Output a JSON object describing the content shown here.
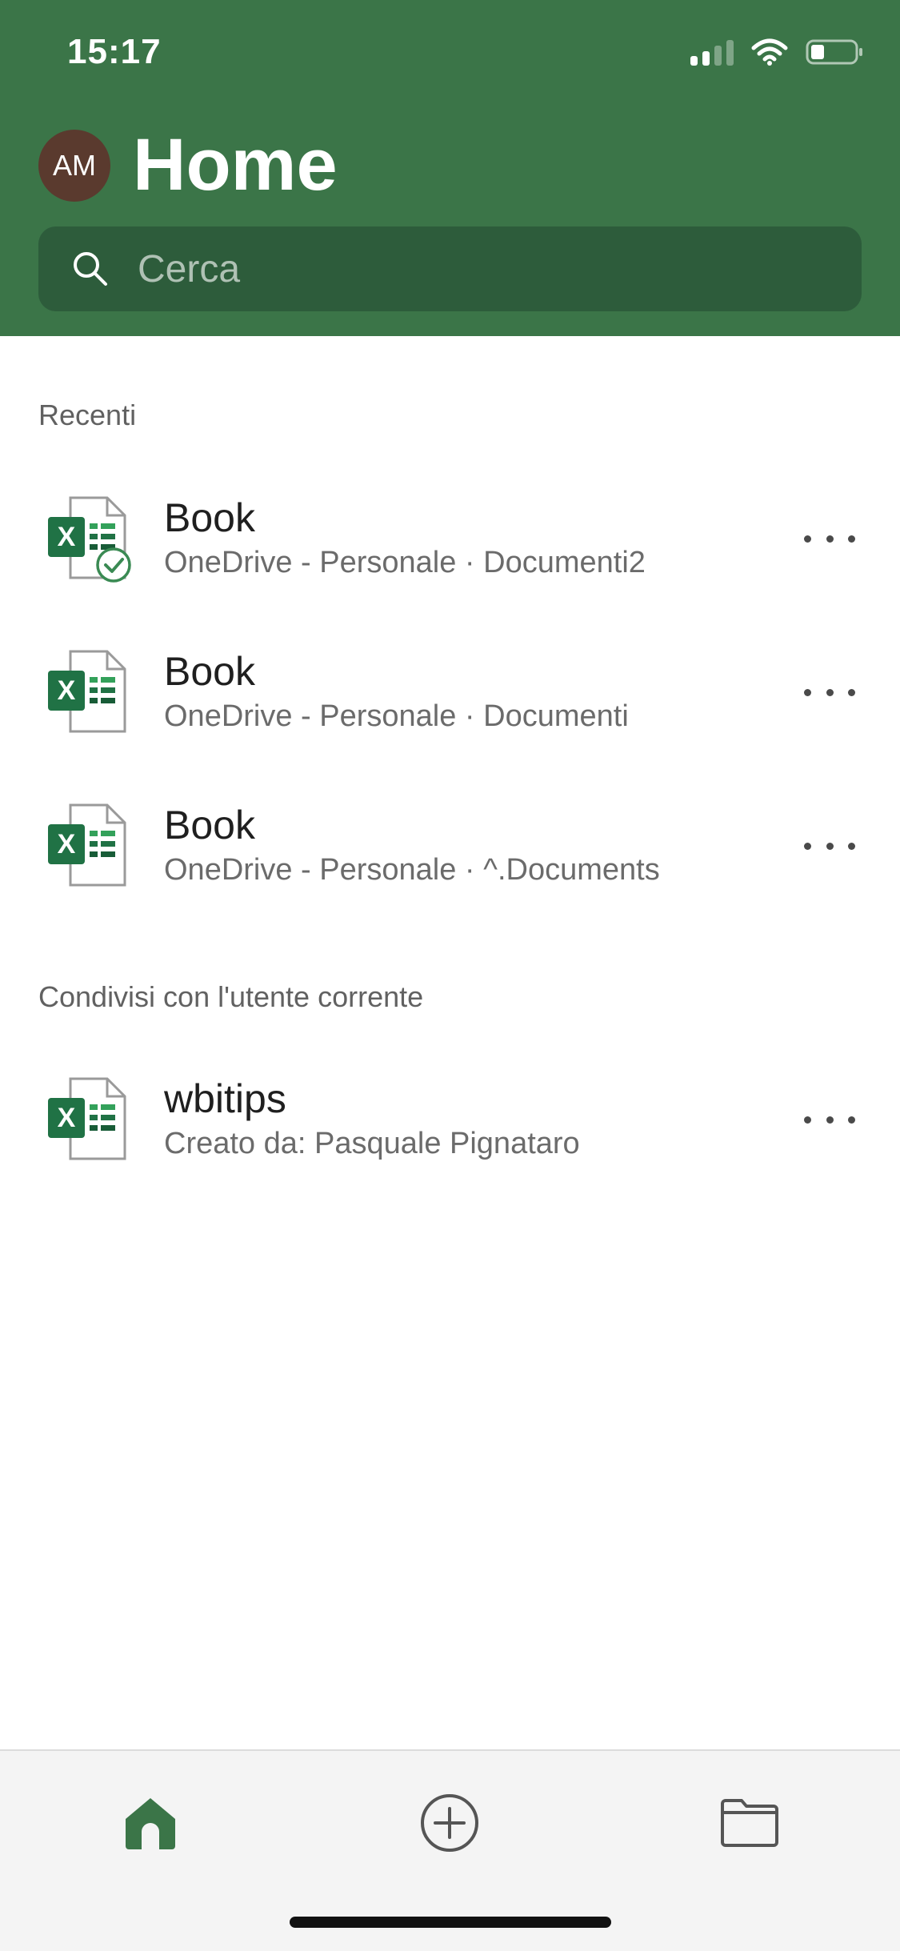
{
  "status_bar": {
    "time": "15:17"
  },
  "header": {
    "avatar_initials": "AM",
    "title": "Home"
  },
  "search": {
    "placeholder": "Cerca"
  },
  "sections": {
    "recent_title": "Recenti",
    "shared_title": "Condivisi con l'utente corrente"
  },
  "recent_files": [
    {
      "name": "Book",
      "location": "OneDrive - Personale · Documenti2",
      "synced": true
    },
    {
      "name": "Book",
      "location": "OneDrive - Personale · Documenti",
      "synced": false
    },
    {
      "name": "Book",
      "location": "OneDrive - Personale · ^.Documents",
      "synced": false
    }
  ],
  "shared_files": [
    {
      "name": "wbitips",
      "location": "Creato da: Pasquale Pignataro"
    }
  ],
  "tabs": {
    "active": "home",
    "items": [
      "home-icon",
      "add-circle-icon",
      "folder-icon"
    ]
  },
  "colors": {
    "brand_green": "#3b7548",
    "search_bg": "#2d5c3b",
    "avatar_bg": "#5a3a2e",
    "excel_green": "#207245"
  }
}
